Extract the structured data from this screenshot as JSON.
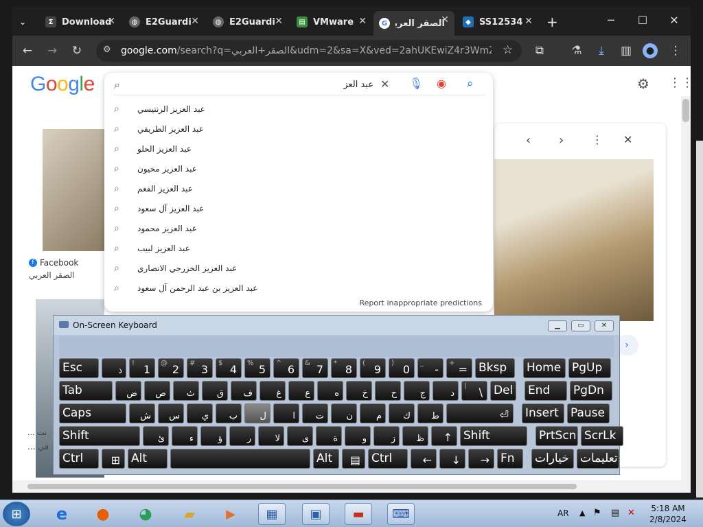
{
  "browser": {
    "tabs": [
      {
        "title": "Download",
        "icon": "sigma-icon",
        "color": "#e8e8e8"
      },
      {
        "title": "E2Guardi",
        "icon": "globe-icon",
        "color": "#e8e8e8"
      },
      {
        "title": "E2Guardi",
        "icon": "globe-icon",
        "color": "#e8e8e8"
      },
      {
        "title": "VMware",
        "icon": "vmware-icon",
        "color": "#e8e8e8"
      },
      {
        "title": "الصقر العربي",
        "icon": "google-icon",
        "color": "#e8e8e8",
        "active": true
      },
      {
        "title": "SS12534",
        "icon": "drop-icon",
        "color": "#e8e8e8"
      }
    ],
    "new_tab": "+",
    "url_host": "google.com",
    "url_rest": "/search?q=الصقر+العربي&udm=2&sa=X&ved=2ahUKEwiZ4r3WmZuEAxVXE..."
  },
  "google": {
    "logo": "Google",
    "query": "عبد العز",
    "suggestions": [
      "عبد العزيز الرنتيسي",
      "عبد العزيز الطريفي",
      "عبد العزيز الحلو",
      "عبد العزيز مخيون",
      "عبد العزيز الفغم",
      "عبد العزيز آل سعود",
      "عبد العزيز محمود",
      "عبد العزيز لبيب",
      "عبد العزيز الخزرجي الانصاري",
      "عبد العزيز بن عبد الرحمن آل سعود"
    ],
    "report": "Report inappropriate predictions",
    "result_source": "Facebook",
    "result_title": "الصقر العربي",
    "result2_source": "... نت",
    "result2_title": "... في"
  },
  "osk": {
    "title": "On-Screen Keyboard",
    "rows": [
      [
        [
          "Esc",
          ""
        ],
        [
          "ذ",
          ""
        ],
        [
          "1",
          "!"
        ],
        [
          "2",
          "@"
        ],
        [
          "3",
          "#"
        ],
        [
          "4",
          "$"
        ],
        [
          "5",
          "%"
        ],
        [
          "6",
          "^"
        ],
        [
          "7",
          "&"
        ],
        [
          "8",
          "*"
        ],
        [
          "9",
          "("
        ],
        [
          "0",
          ")"
        ],
        [
          "-",
          "_"
        ],
        [
          "=",
          "+"
        ],
        [
          "Bksp",
          ""
        ],
        [
          "Home",
          ""
        ],
        [
          "PgUp",
          ""
        ]
      ],
      [
        [
          "Tab",
          ""
        ],
        [
          "ض",
          ""
        ],
        [
          "ص",
          ""
        ],
        [
          "ث",
          ""
        ],
        [
          "ق",
          ""
        ],
        [
          "ف",
          ""
        ],
        [
          "غ",
          ""
        ],
        [
          "ع",
          ""
        ],
        [
          "ه",
          ""
        ],
        [
          "خ",
          ""
        ],
        [
          "ح",
          ""
        ],
        [
          "ج",
          ""
        ],
        [
          "د",
          ""
        ],
        [
          "\\",
          "|"
        ],
        [
          "Del",
          ""
        ],
        [
          "End",
          ""
        ],
        [
          "PgDn",
          ""
        ]
      ],
      [
        [
          "Caps",
          ""
        ],
        [
          "ش",
          ""
        ],
        [
          "س",
          ""
        ],
        [
          "ي",
          ""
        ],
        [
          "ب",
          ""
        ],
        [
          "ل",
          ""
        ],
        [
          "ا",
          ""
        ],
        [
          "ت",
          ""
        ],
        [
          "ن",
          ""
        ],
        [
          "م",
          ""
        ],
        [
          "ك",
          ""
        ],
        [
          "ط",
          ""
        ],
        [
          "⏎",
          ""
        ],
        [
          "Insert",
          ""
        ],
        [
          "Pause",
          ""
        ]
      ],
      [
        [
          "Shift",
          ""
        ],
        [
          "ئ",
          ""
        ],
        [
          "ء",
          ""
        ],
        [
          "ؤ",
          ""
        ],
        [
          "ر",
          ""
        ],
        [
          "لا",
          ""
        ],
        [
          "ى",
          ""
        ],
        [
          "ة",
          ""
        ],
        [
          "و",
          ""
        ],
        [
          "ز",
          ""
        ],
        [
          "ظ",
          ""
        ],
        [
          "↑",
          ""
        ],
        [
          "Shift",
          ""
        ],
        [
          "PrtScn",
          ""
        ],
        [
          "ScrLk",
          ""
        ]
      ],
      [
        [
          "Ctrl",
          ""
        ],
        [
          "⊞",
          ""
        ],
        [
          "Alt",
          ""
        ],
        [
          "",
          ""
        ],
        [
          "Alt",
          ""
        ],
        [
          "▤",
          ""
        ],
        [
          "Ctrl",
          ""
        ],
        [
          "←",
          ""
        ],
        [
          "↓",
          ""
        ],
        [
          "→",
          ""
        ],
        [
          "Fn",
          ""
        ],
        [
          "خيارات",
          ""
        ],
        [
          "تعليمات",
          ""
        ]
      ]
    ]
  },
  "taskbar": {
    "lang": "AR",
    "time": "5:18 AM",
    "date": "2/8/2024"
  }
}
